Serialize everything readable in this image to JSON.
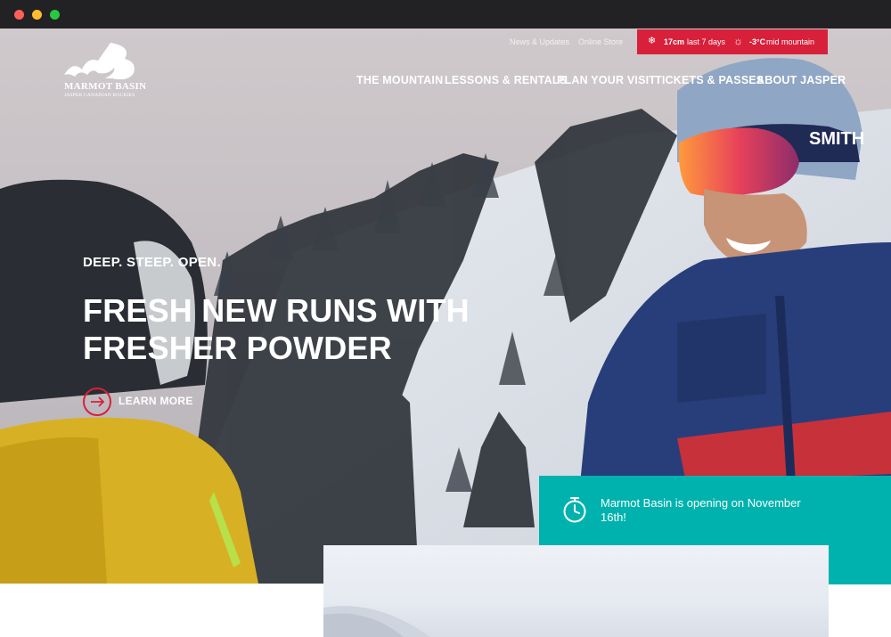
{
  "window": {
    "controls": [
      "close",
      "minimize",
      "maximize"
    ]
  },
  "brand": {
    "name": "MARMOT BASIN",
    "tagline": "JASPER CANADIAN ROCKIES",
    "accent": "#d8203b",
    "teal": "#00b2ae"
  },
  "utility": {
    "news": "News & Updates",
    "store": "Online Store"
  },
  "conditions": {
    "snow_icon": "snowflake-icon",
    "snow_value": "17cm",
    "snow_label": "last 7 days",
    "temp_icon": "sun-icon",
    "temp_value": "-3°C",
    "temp_label": "mid mountain"
  },
  "nav": {
    "items": [
      {
        "label": "THE MOUNTAIN"
      },
      {
        "label": "LESSONS & RENTALS"
      },
      {
        "label": "PLAN YOUR VISIT"
      },
      {
        "label": "TICKETS & PASSES"
      },
      {
        "label": "ABOUT JASPER"
      }
    ]
  },
  "hero": {
    "eyebrow": "DEEP. STEEP. OPEN.",
    "headline_line1": "FRESH NEW RUNS WITH",
    "headline_line2": "FRESHER POWDER",
    "cta_label": "LEARN MORE",
    "helmet_brand": "SMITH"
  },
  "announcement": {
    "icon": "stopwatch-icon",
    "text": "Marmot Basin is opening on November 16th!"
  }
}
